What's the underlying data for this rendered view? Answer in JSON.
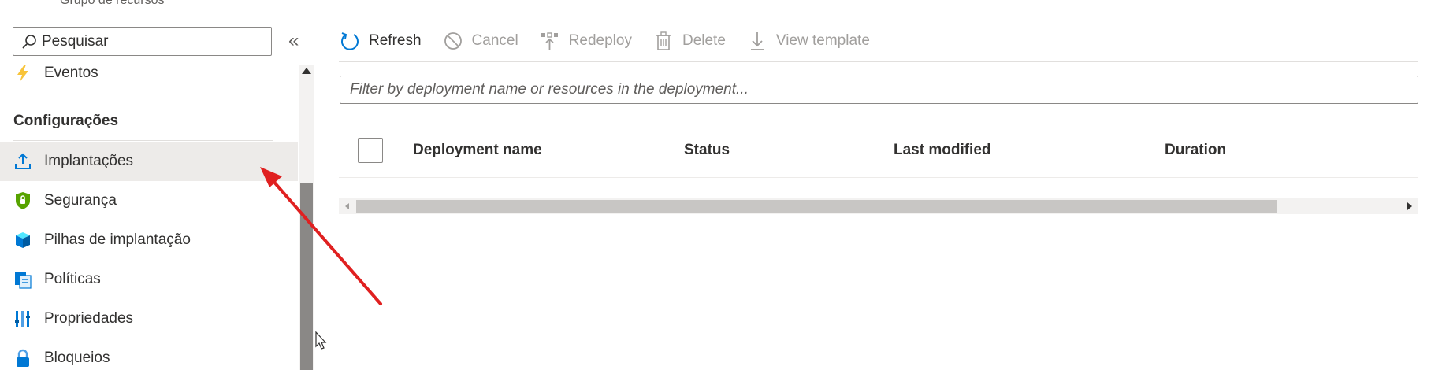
{
  "nav": {
    "subtitle": "Grupo de recursos",
    "search": {
      "placeholder": "Pesquisar"
    },
    "collapse_glyph": "«",
    "items_top": [
      {
        "label": "Eventos",
        "icon": "lightning-icon"
      }
    ],
    "section_header": "Configurações",
    "items": [
      {
        "label": "Implantações",
        "icon": "upload-icon",
        "selected": true
      },
      {
        "label": "Segurança",
        "icon": "shield-icon"
      },
      {
        "label": "Pilhas de implantação",
        "icon": "cube-stack-icon"
      },
      {
        "label": "Políticas",
        "icon": "policy-document-icon"
      },
      {
        "label": "Propriedades",
        "icon": "properties-bars-icon"
      },
      {
        "label": "Bloqueios",
        "icon": "lock-icon"
      }
    ]
  },
  "toolbar": {
    "refresh": "Refresh",
    "cancel": "Cancel",
    "redeploy": "Redeploy",
    "delete": "Delete",
    "view_template": "View template"
  },
  "filter": {
    "placeholder": "Filter by deployment name or resources in the deployment..."
  },
  "grid": {
    "columns": [
      "Deployment name",
      "Status",
      "Last modified",
      "Duration"
    ]
  },
  "colors": {
    "accent": "#0078d4",
    "selected_bg": "#edebe9",
    "annotation_arrow": "#e02020",
    "disabled_text": "#a19f9d"
  }
}
